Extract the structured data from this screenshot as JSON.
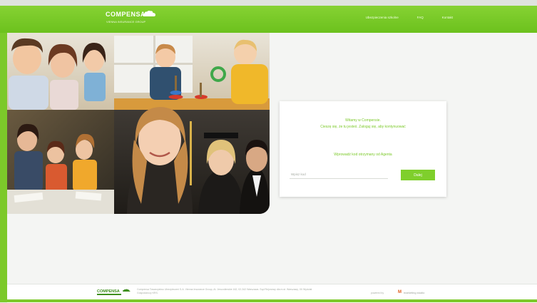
{
  "header": {
    "logo_text": "COMPENSA",
    "logo_tagline": "VIENNA INSURANCE GROUP",
    "nav": [
      {
        "label": "Ubezpieczenia szkolne"
      },
      {
        "label": "FAQ"
      },
      {
        "label": "Kontakt"
      }
    ]
  },
  "login": {
    "welcome_line1": "Witamy w Compensie.",
    "welcome_line2": "Cieszę się, że tu jesteś. Zaloguj się, aby kontynuować",
    "prompt": "Wprowadź kod otrzymany od Agenta",
    "code_placeholder": "Wpisz kod",
    "submit_label": "Dalej"
  },
  "footer": {
    "logo_text": "COMPENSA",
    "text": "Compensa Towarzystwo Ubezpieczeń S.A. Vienna Insurance Group, Al. Jerozolimskie 162, 02-342 Warszawa. Sąd Rejonowy dla m.st. Warszawy, XII Wydział Gospodarczy KRS.",
    "powered_label": "powered by",
    "partner_mark": "M",
    "partner_name": "marketing studio"
  },
  "colors": {
    "brand_green": "#7cc92a",
    "header_green": "#6cc11d",
    "button_green": "#7fcf2c",
    "partner_orange": "#e05a1a"
  }
}
